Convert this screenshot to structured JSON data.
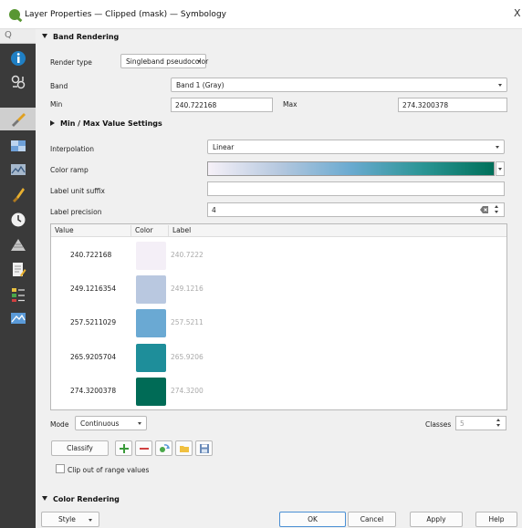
{
  "window": {
    "title": "Layer Properties — Clipped (mask) — Symbology",
    "close_glyph": "X"
  },
  "sidebar": {
    "search_glyph": "Q",
    "items": [
      {
        "icon": "information-icon",
        "color": "#1f7fc4"
      },
      {
        "icon": "source-icon",
        "color": "#e0e0e0"
      },
      {
        "icon": "symbology-icon",
        "color": "#e0a020"
      },
      {
        "icon": "transparency-icon",
        "color": "#6ea0d8"
      },
      {
        "icon": "histogram-icon",
        "color": "#a6b8cc"
      },
      {
        "icon": "rendering-icon",
        "color": "#e8b030"
      },
      {
        "icon": "temporal-icon",
        "color": "#f0f0f0"
      },
      {
        "icon": "pyramids-icon",
        "color": "#c8c8c8"
      },
      {
        "icon": "metadata-icon",
        "color": "#f0f0f0"
      },
      {
        "icon": "legend-icon",
        "color": "#e8c040"
      },
      {
        "icon": "server-icon",
        "color": "#5a9ad8"
      }
    ]
  },
  "band_rendering": {
    "title": "Band Rendering",
    "render_type_label": "Render type",
    "render_type_value": "Singleband pseudocolor",
    "band_label": "Band",
    "band_value": "Band 1 (Gray)",
    "min_label": "Min",
    "min_value": "240.722168",
    "max_label": "Max",
    "max_value": "274.3200378",
    "minmax_settings_title": "Min / Max Value Settings",
    "interpolation_label": "Interpolation",
    "interpolation_value": "Linear",
    "color_ramp_label": "Color ramp",
    "label_unit_suffix_label": "Label unit suffix",
    "label_unit_suffix_value": "",
    "label_precision_label": "Label precision",
    "label_precision_value": "4",
    "table": {
      "headers": [
        "Value",
        "Color",
        "Label"
      ],
      "rows": [
        {
          "value": "240.722168",
          "color": "#f4eff7",
          "label": "240.7222"
        },
        {
          "value": "249.1216354",
          "color": "#b9c8e0",
          "label": "249.1216"
        },
        {
          "value": "257.5211029",
          "color": "#6aa9d3",
          "label": "257.5211"
        },
        {
          "value": "265.9205704",
          "color": "#1e8e9a",
          "label": "265.9206"
        },
        {
          "value": "274.3200378",
          "color": "#006b56",
          "label": "274.3200"
        }
      ]
    },
    "mode_label": "Mode",
    "mode_value": "Continuous",
    "classes_label": "Classes",
    "classes_value": "5",
    "classify_label": "Classify",
    "clip_label": "Clip out of range values"
  },
  "color_rendering": {
    "title": "Color Rendering"
  },
  "footer": {
    "style_label": "Style",
    "ok_label": "OK",
    "cancel_label": "Cancel",
    "apply_label": "Apply",
    "help_label": "Help"
  }
}
